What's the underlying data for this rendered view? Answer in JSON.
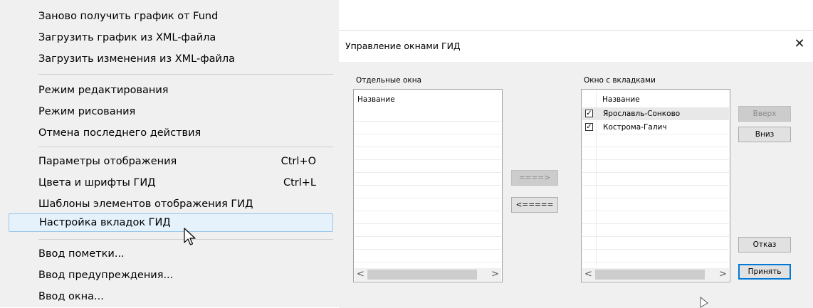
{
  "menu": {
    "items": [
      {
        "label": "Заново получить график от Fund",
        "shortcut": ""
      },
      {
        "label": "Загрузить график из XML-файла",
        "shortcut": ""
      },
      {
        "label": "Загрузить изменения из XML-файла",
        "shortcut": ""
      },
      {
        "label": "Режим редактирования",
        "shortcut": ""
      },
      {
        "label": "Режим рисования",
        "shortcut": ""
      },
      {
        "label": "Отмена последнего действия",
        "shortcut": ""
      },
      {
        "label": "Параметры отображения",
        "shortcut": "Ctrl+O"
      },
      {
        "label": "Цвета и шрифты ГИД",
        "shortcut": "Ctrl+L"
      },
      {
        "label": "Шаблоны элементов отображения ГИД",
        "shortcut": ""
      },
      {
        "label": "Настройка вкладок ГИД",
        "shortcut": ""
      },
      {
        "label": "Ввод пометки...",
        "shortcut": ""
      },
      {
        "label": "Ввод предупреждения...",
        "shortcut": ""
      },
      {
        "label": "Ввод окна...",
        "shortcut": ""
      }
    ],
    "hovered_item": "Настройка вкладок ГИД"
  },
  "dialog": {
    "title": "Управление окнами ГИД",
    "close_glyph": "✕",
    "left_label": "Отдельные окна",
    "right_label": "Окно с вкладками",
    "left_list": {
      "header": "Название",
      "rows": []
    },
    "right_list": {
      "header": "Название",
      "rows": [
        {
          "name": "Ярославль-Сонково",
          "checked": true,
          "selected": true
        },
        {
          "name": "Кострома-Галич",
          "checked": true,
          "selected": false
        }
      ]
    },
    "buttons": {
      "move_right": "====>",
      "move_left": "<=====",
      "up": "Вверх",
      "down": "Вниз",
      "cancel": "Отказ",
      "accept": "Принять"
    },
    "scroll_left_glyph": "<",
    "scroll_right_glyph": ">",
    "check_glyph": "✓"
  }
}
